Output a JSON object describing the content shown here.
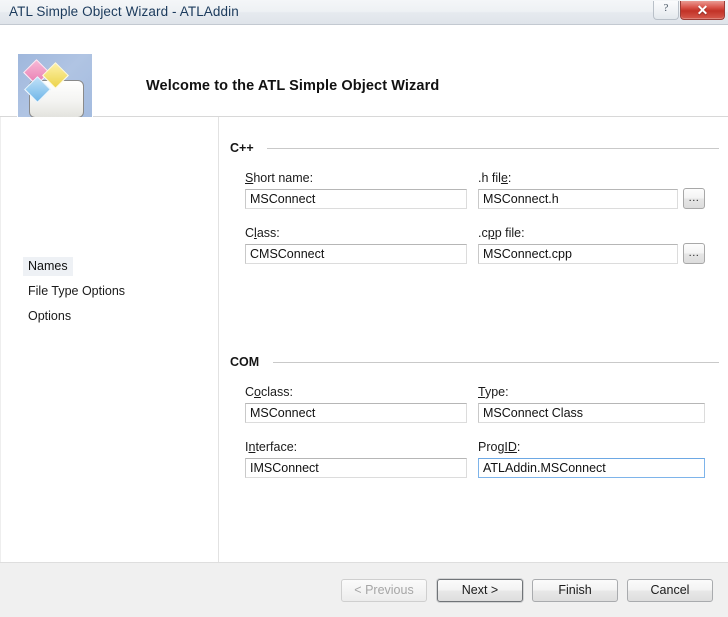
{
  "window": {
    "title": "ATL Simple Object Wizard - ATLAddin",
    "help_label": "?",
    "close_label": "✕"
  },
  "header": {
    "title": "Welcome to the ATL Simple Object Wizard",
    "icon": "atl-simple-object-wizard-icon"
  },
  "sidebar": {
    "items": [
      {
        "label": "Names",
        "selected": true
      },
      {
        "label": "File Type Options",
        "selected": false
      },
      {
        "label": "Options",
        "selected": false
      }
    ]
  },
  "groups": {
    "cpp": {
      "label": "C++",
      "fields": {
        "short_name": {
          "label": "Short name:",
          "accel": "S",
          "value": "MSConnect"
        },
        "h_file": {
          "label": ".h file:",
          "accel": "e",
          "value": "MSConnect.h",
          "browse": "..."
        },
        "class": {
          "label": "Class:",
          "accel": "l",
          "value": "CMSConnect"
        },
        "cpp_file": {
          "label": ".cpp file:",
          "accel": "p",
          "value": "MSConnect.cpp",
          "browse": "..."
        }
      }
    },
    "com": {
      "label": "COM",
      "fields": {
        "coclass": {
          "label": "Coclass:",
          "accel": "o",
          "value": "MSConnect"
        },
        "type": {
          "label": "Type:",
          "accel": "T",
          "value": "MSConnect Class"
        },
        "interface": {
          "label": "Interface:",
          "accel": "n",
          "value": "IMSConnect"
        },
        "progid": {
          "label": "ProgID:",
          "accel": "D",
          "value": "ATLAddin.MSConnect",
          "focused": true
        }
      }
    }
  },
  "footer": {
    "buttons": [
      {
        "label": "< Previous",
        "state": "disabled"
      },
      {
        "label": "Next >",
        "state": "default"
      },
      {
        "label": "Finish",
        "state": "normal"
      },
      {
        "label": "Cancel",
        "state": "normal"
      }
    ]
  },
  "colors": {
    "close_red": "#c23227",
    "selection": "#eef1f5",
    "focus_border": "#7eb4ea",
    "title_text": "#1b3a5c"
  }
}
